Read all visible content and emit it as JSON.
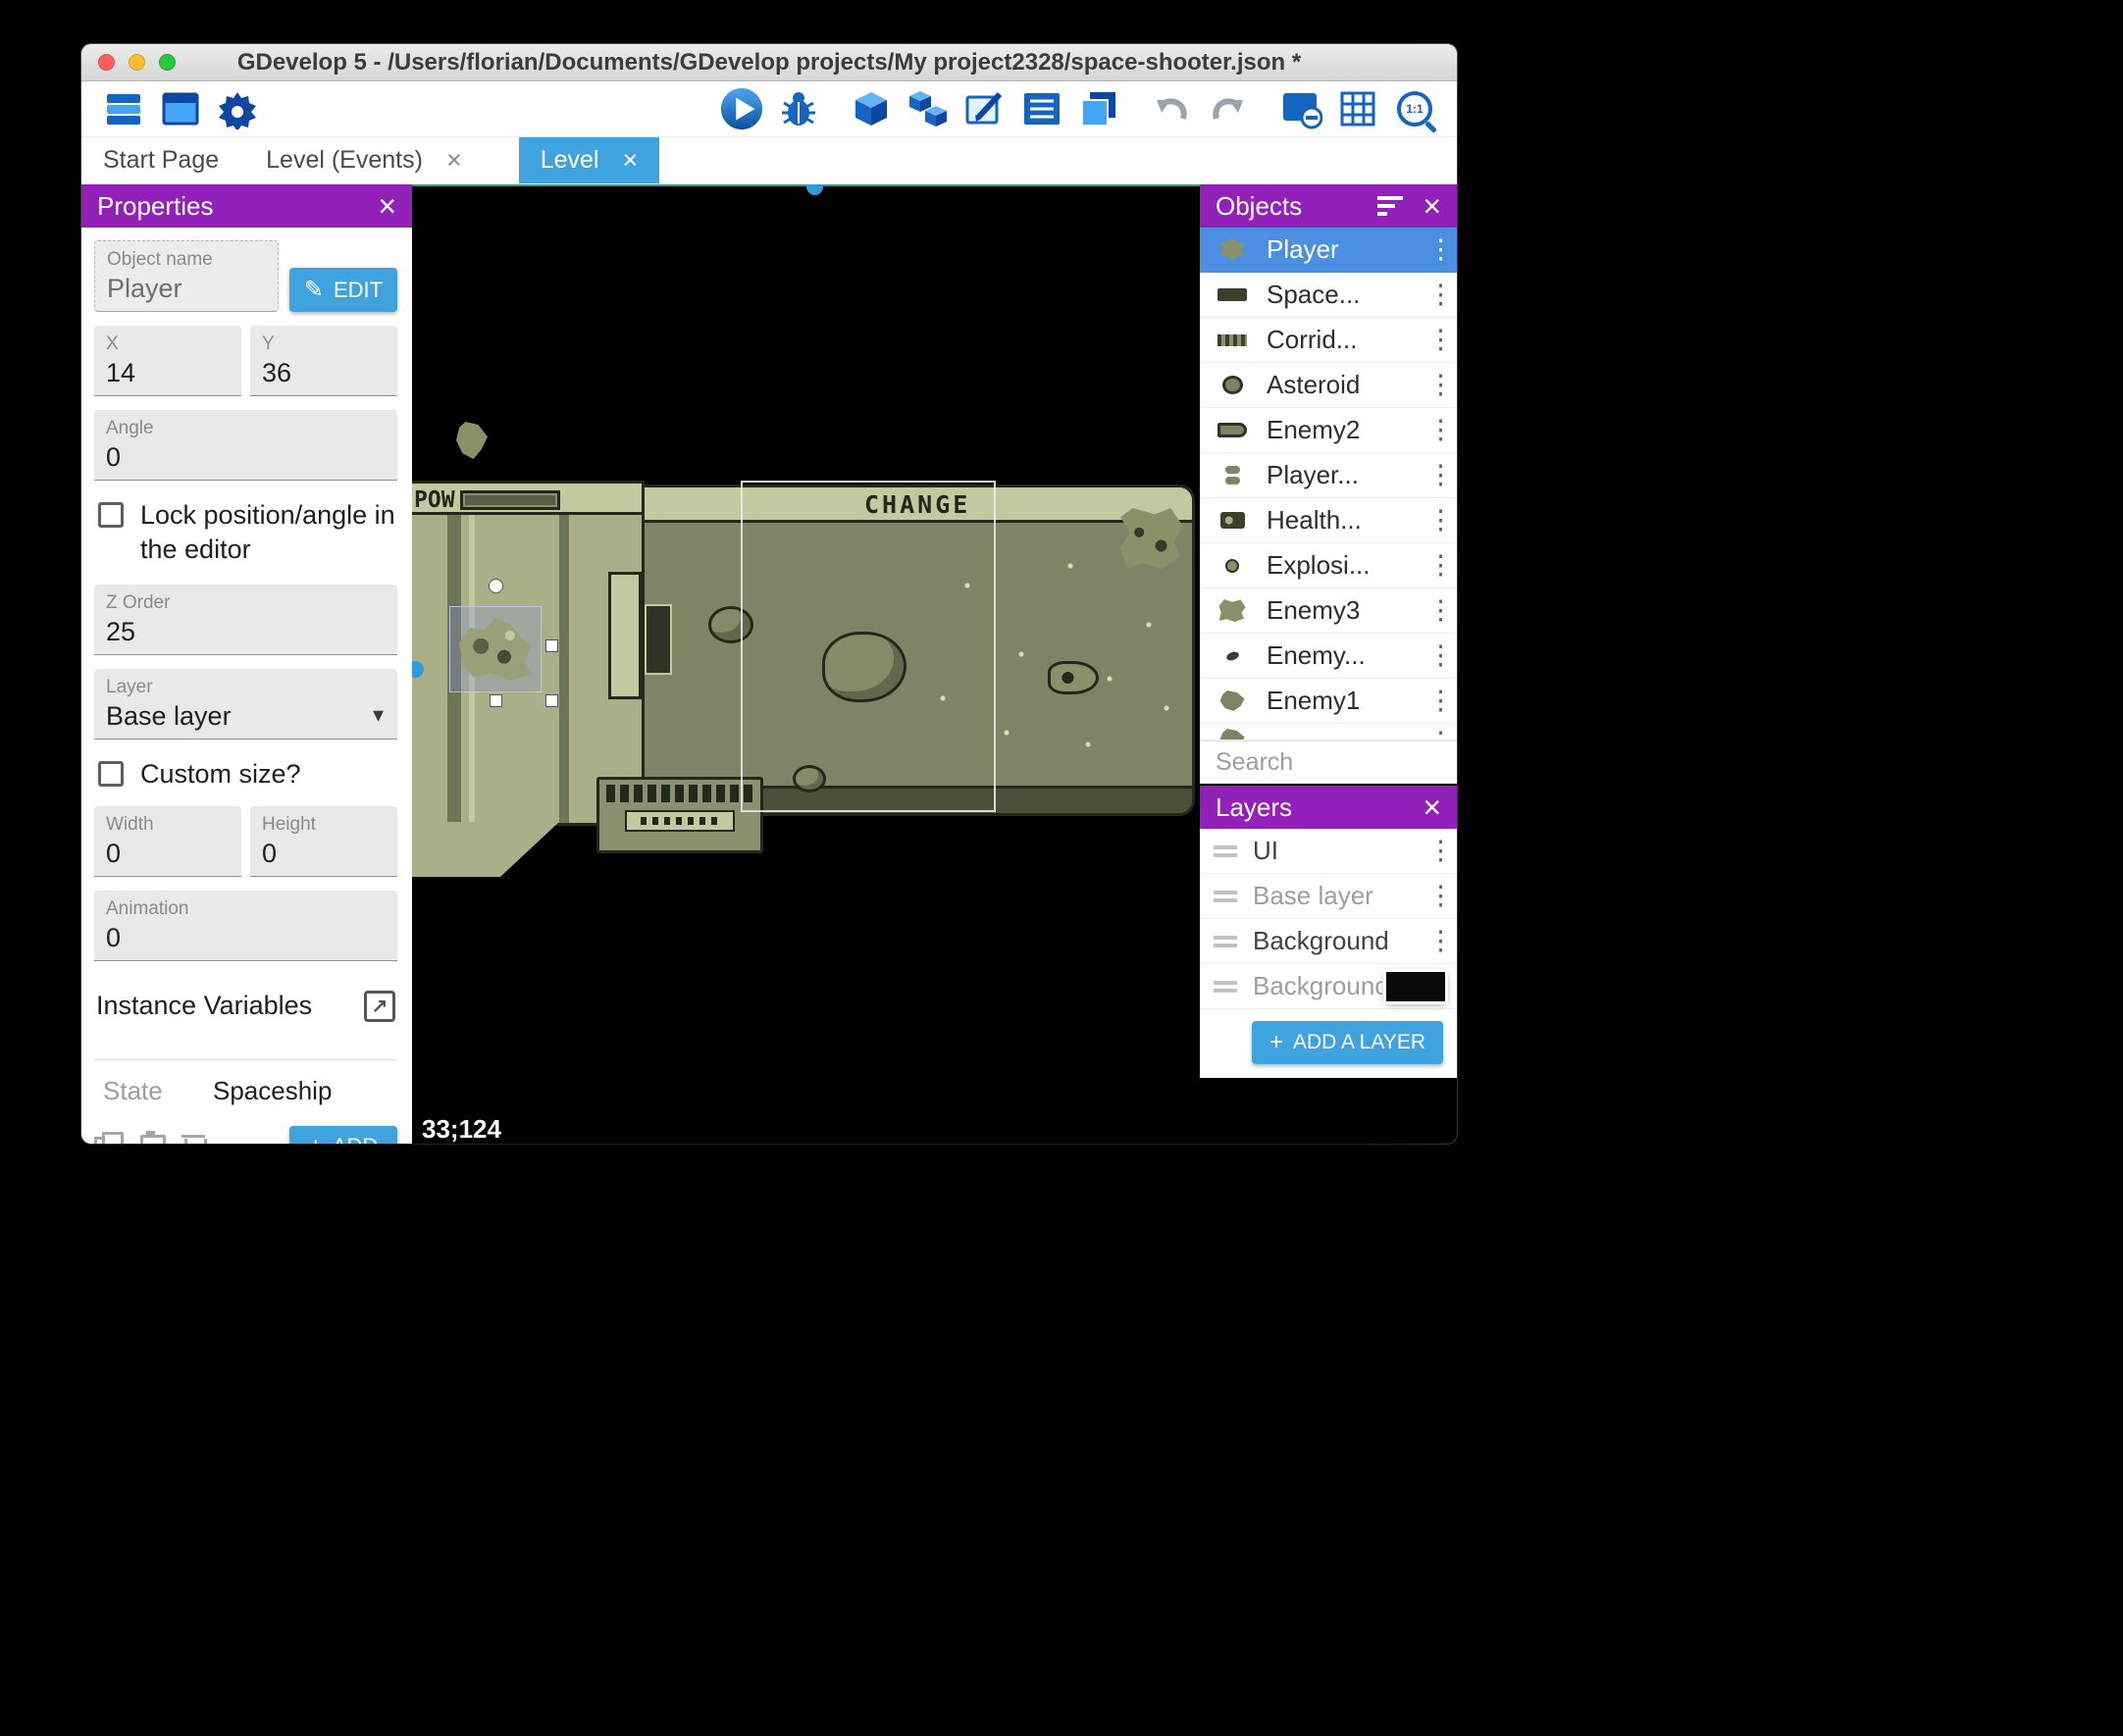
{
  "window": {
    "title": "GDevelop 5 - /Users/florian/Documents/GDevelop projects/My project2328/space-shooter.json *"
  },
  "icons": {
    "close": "×",
    "dots": "⋮",
    "dropdown": "▾",
    "plus": "+",
    "pencil": "✎",
    "external": "↗",
    "zoom_ratio": "1:1"
  },
  "tabs": {
    "start_page": "Start Page",
    "level_events": "Level (Events)",
    "level": "Level"
  },
  "properties": {
    "title": "Properties",
    "object_name_label": "Object name",
    "object_name_value": "Player",
    "edit_button": "EDIT",
    "x_label": "X",
    "x_value": "14",
    "y_label": "Y",
    "y_value": "36",
    "angle_label": "Angle",
    "angle_value": "0",
    "lock_label": "Lock position/angle in the editor",
    "z_order_label": "Z Order",
    "z_order_value": "25",
    "layer_label": "Layer",
    "layer_value": "Base layer",
    "custom_size_label": "Custom size?",
    "width_label": "Width",
    "width_value": "0",
    "height_label": "Height",
    "height_value": "0",
    "animation_label": "Animation",
    "animation_value": "0",
    "instance_variables_label": "Instance Variables",
    "state_tab": "State",
    "spaceship_tab": "Spaceship",
    "add_button": "ADD"
  },
  "scene": {
    "hud_pow": "POW",
    "hud_change": "CHANGE",
    "cursor_coords": "33;124"
  },
  "objects_panel": {
    "title": "Objects",
    "search_placeholder": "Search",
    "items": [
      {
        "name": "Player"
      },
      {
        "name": "Space..."
      },
      {
        "name": "Corrid..."
      },
      {
        "name": "Asteroid"
      },
      {
        "name": "Enemy2"
      },
      {
        "name": "Player..."
      },
      {
        "name": "Health..."
      },
      {
        "name": "Explosi..."
      },
      {
        "name": "Enemy3"
      },
      {
        "name": "Enemy..."
      },
      {
        "name": "Enemy1"
      }
    ]
  },
  "layers_panel": {
    "title": "Layers",
    "items": [
      {
        "name": "UI"
      },
      {
        "name": "Base layer"
      },
      {
        "name": "Background"
      },
      {
        "name": "Backgrounc"
      }
    ],
    "add_button": "ADD A LAYER"
  },
  "colors": {
    "panel_header_purple": "#9320b8",
    "accent_blue": "#3fa3df",
    "selected_row_blue": "#4a8fe2",
    "toolbar_icon_blue": "#1565c0",
    "scene_olive_light": "#c2c99e",
    "scene_olive_mid": "#7e8566",
    "scene_olive_dark": "#22281a"
  }
}
